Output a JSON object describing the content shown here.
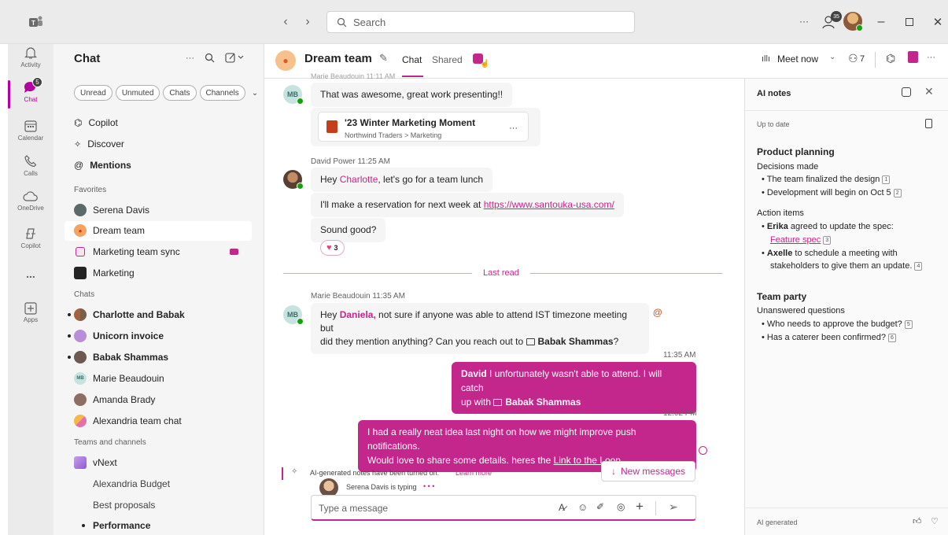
{
  "titlebar": {
    "search_placeholder": "Search",
    "more": "···",
    "presence_count": "35"
  },
  "rail": {
    "items": [
      {
        "label": "Activity"
      },
      {
        "label": "Chat",
        "badge": "5"
      },
      {
        "label": "Calendar"
      },
      {
        "label": "Calls"
      },
      {
        "label": "OneDrive"
      },
      {
        "label": "Copilot"
      },
      {
        "label": "..."
      },
      {
        "label": "Apps"
      }
    ]
  },
  "left": {
    "title": "Chat",
    "filters": [
      "Unread",
      "Unmuted",
      "Chats",
      "Channels"
    ],
    "top": [
      "Copilot",
      "Discover",
      "Mentions"
    ],
    "favorites_label": "Favorites",
    "favorites": [
      "Serena Davis",
      "Dream team",
      "Marketing team sync",
      "Marketing"
    ],
    "chats_label": "Chats",
    "chats": [
      "Charlotte and Babak",
      "Unicorn invoice",
      "Babak Shammas",
      "Marie Beaudouin",
      "Amanda Brady",
      "Alexandria team chat"
    ],
    "teams_label": "Teams and channels",
    "teams": [
      "vNext",
      "Alexandria Budget",
      "Best proposals",
      "Performance"
    ]
  },
  "header": {
    "team": "Dream team",
    "tabs": [
      "Chat",
      "Shared"
    ],
    "meet_now": "Meet now",
    "participants": "7"
  },
  "messages": {
    "top_sender": "Marie Beaudouin  11:11 AM",
    "m1": "That was awesome, great work presenting!!",
    "file_title": "'23 Winter Marketing Moment",
    "file_path": "Northwind Traders > Marketing",
    "file_more": "···",
    "david_meta": "David Power  11:25 AM",
    "d1_pre": "Hey ",
    "d1_mention": "Charlotte",
    "d1_post": ", let's go for a team lunch",
    "d2_pre": "I'll make a reservation for next week at ",
    "d2_link": "https://www.santouka-usa.com/",
    "d3": "Sound good?",
    "reaction_count": "3",
    "last_read": "Last read",
    "marie_meta": "Marie Beaudouin  11:35 AM",
    "mb_initials": "MB",
    "m2_pre": "Hey ",
    "m2_mention": "Daniela,",
    "m2_mid": " not sure if anyone was able to attend IST timezone meeting but",
    "m2_line2": "did they mention anything? Can you reach out to ",
    "m2_card": "Babak Shammas",
    "m2_end": "?",
    "me1_time": "11:35 AM",
    "me1_name": "David",
    "me1_text": " I unfortunately wasn't able to attend. I will catch",
    "me1_line2": "up with ",
    "me1_card": "Babak Shammas",
    "me2_time": "12:02 PM",
    "me2_line1": "I had a really neat idea last night on how we might improve push notifications.",
    "me2_line2": "Would love to share some details. heres the ",
    "me2_link": "Link to the Loop",
    "ai_banner": "AI-generated notes have been turned on.",
    "learn_more": "Learn more",
    "new_messages": "New messages",
    "typing": "Serena Davis is typing",
    "compose_placeholder": "Type a message"
  },
  "ainotes": {
    "title": "AI notes",
    "status": "Up to date",
    "s1_title": "Product planning",
    "s1_sub": "Decisions made",
    "s1_i1": "The team finalized the design",
    "s1_i2": "Development will begin on Oct 5",
    "s1_sub2": "Action items",
    "s1_a1_name": "Erika",
    "s1_a1_text": " agreed to update the spec:",
    "s1_a1_link": "Feature spec",
    "s1_a2_name": "Axelle",
    "s1_a2_text": " to schedule a meeting with",
    "s1_a2_line2": "stakeholders to give them an update.",
    "s2_title": "Team party",
    "s2_sub": "Unanswered questions",
    "s2_i1": "Who needs to approve the budget?",
    "s2_i2": "Has a caterer been confirmed?",
    "refs": [
      "1",
      "2",
      "3",
      "4",
      "5",
      "6"
    ],
    "footer": "AI generated"
  },
  "colors": {
    "accent": "#c4278b",
    "rail_active": "#b4009e",
    "green": "#13a10e"
  }
}
